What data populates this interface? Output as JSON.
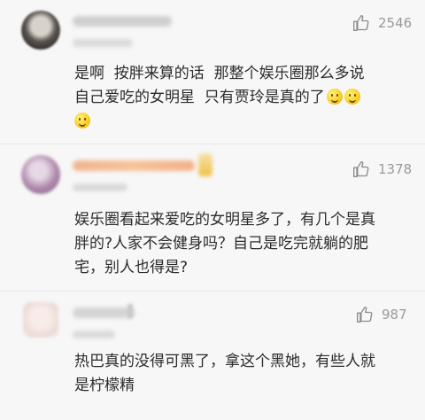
{
  "comments": [
    {
      "likes": "2546",
      "text_lines": [
        "是啊  按胖来算的话  那整个娱乐圈那么多说",
        "自己爱吃的女明星  只有贾玲是真的了"
      ],
      "emoji_count_line2": 2,
      "emoji_count_line3": 1
    },
    {
      "likes": "1378",
      "text_lines": [
        "娱乐圈看起来爱吃的女明星多了，有几个是真",
        "胖的?人家不会健身吗？自己是吃完就躺的肥",
        "宅，别人也得是?"
      ]
    },
    {
      "likes": "987",
      "text_lines": [
        "热巴真的没得可黑了，拿这个黑她，有些人就",
        "是柠檬精"
      ]
    }
  ],
  "icons": {
    "like": "thumbs-up-icon",
    "emoji": "smile-emoji-icon"
  },
  "colors": {
    "background": "#f7f7f7",
    "text": "#2b2b2b",
    "count": "#9a9a9a"
  }
}
